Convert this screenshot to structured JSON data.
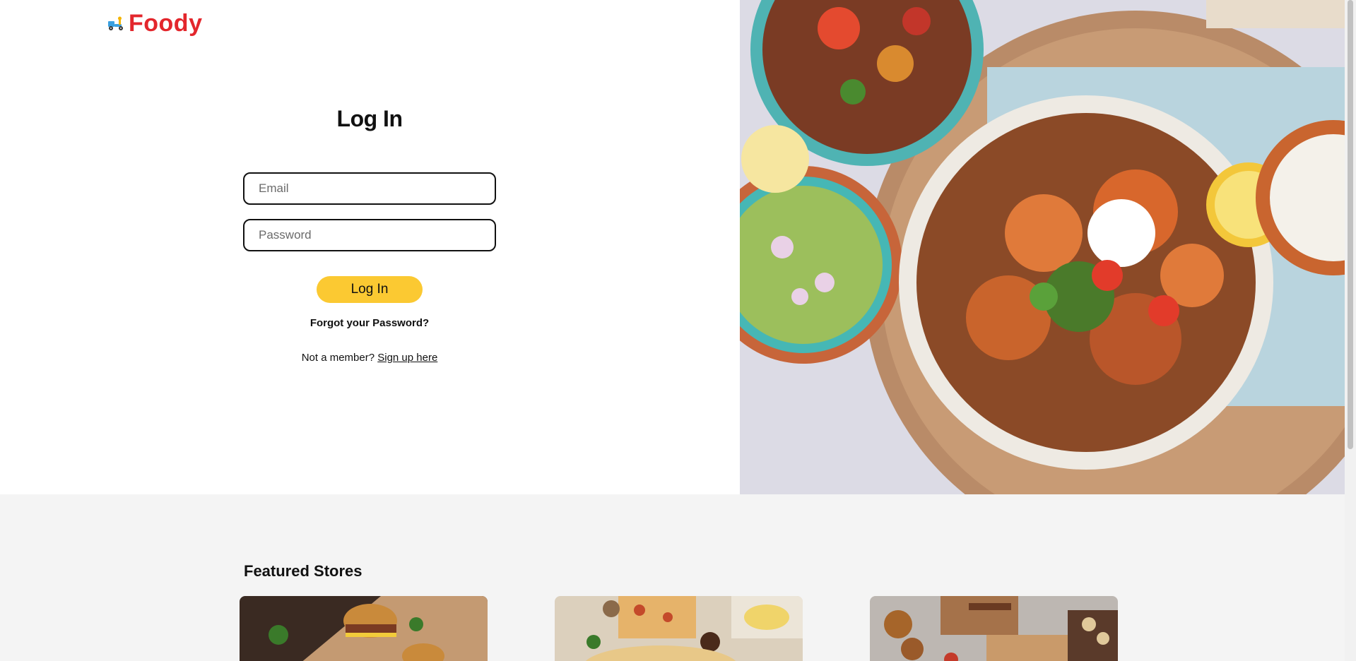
{
  "brand": {
    "name": "Foody",
    "icon": "delivery-scooter-icon",
    "color": "#e3262c"
  },
  "login": {
    "title": "Log In",
    "email_placeholder": "Email",
    "password_placeholder": "Password",
    "submit_label": "Log In",
    "forgot_label": "Forgot your Password?",
    "member_prompt": "Not a member?",
    "signup_label": "Sign up here",
    "accent_color": "#fbc932"
  },
  "featured": {
    "title": "Featured Stores",
    "cards": [
      {
        "image": "burger-photo"
      },
      {
        "image": "pizza-photo"
      },
      {
        "image": "platter-photo"
      }
    ]
  },
  "hero_image": "food-bowl-photo"
}
